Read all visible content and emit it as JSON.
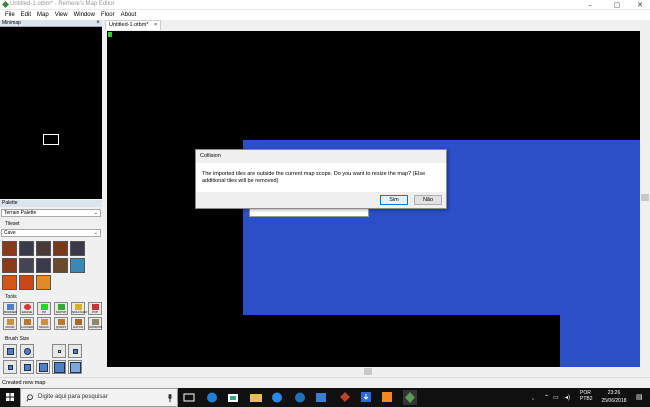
{
  "window": {
    "title": "Untitled-1.otbm* - Remere's Map Editor"
  },
  "menu": [
    "File",
    "Edit",
    "Map",
    "View",
    "Window",
    "Floor",
    "About"
  ],
  "minimap": {
    "title": "Minimap",
    "close": "×"
  },
  "tab": {
    "label": "Untitled-1.otbm*",
    "close": "×"
  },
  "palette": {
    "title": "Palette",
    "selector": "Terrain Palette",
    "tileset_label": "Tileset",
    "tileset": "Cave",
    "tools_label": "Tools",
    "tools": [
      "BORDER",
      "ERASE",
      "PZ",
      "NOPVP",
      "NOLOGOUT",
      "PVP",
      "DOOR",
      "LOCKED",
      "MAGIC",
      "QUEST",
      "HATCH",
      "WINDOW"
    ],
    "brush_size_label": "Brush Size"
  },
  "dialog": {
    "title": "Collision",
    "message": "The imported tiles are outside the current map scope. Do you want to resize the map? (Else additional tiles will be removed)",
    "yes": "Sim",
    "no": "Não"
  },
  "status": "Created new map",
  "taskbar": {
    "search_placeholder": "Digite aqui para pesquisar",
    "lang": "POR\nPTB2",
    "time": "23:26",
    "date": "25/06/2018"
  },
  "colors": {
    "water": "#2a4fc6",
    "canvas": "#000000",
    "accent": "#0078d7"
  }
}
